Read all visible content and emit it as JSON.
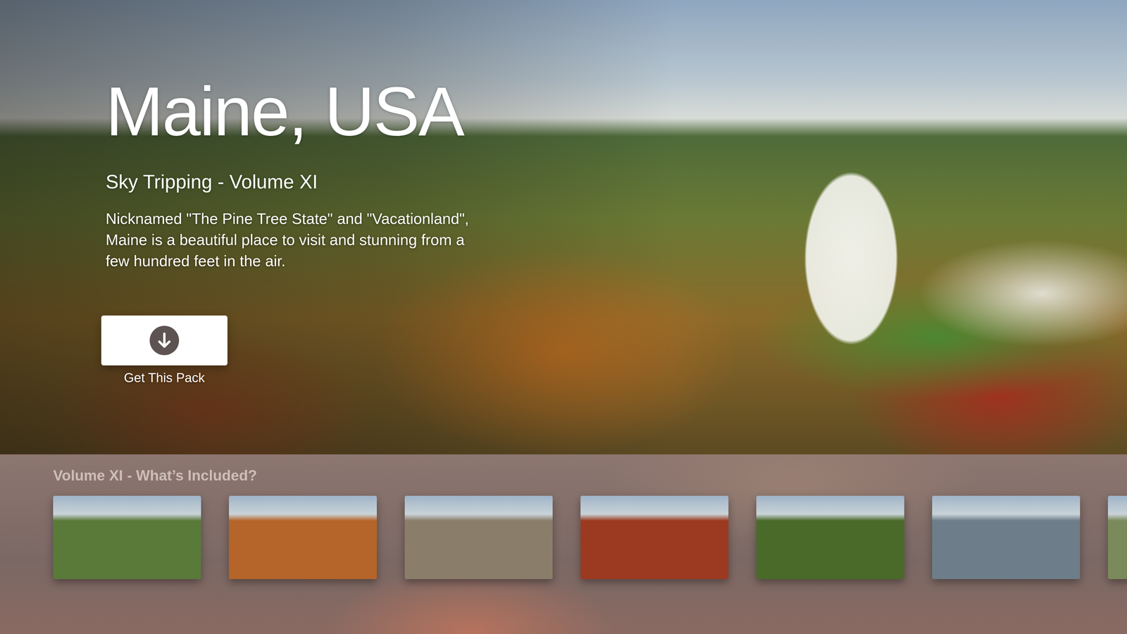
{
  "hero": {
    "title": "Maine, USA",
    "subtitle": "Sky Tripping - Volume XI",
    "description": "Nicknamed \"The Pine Tree State\" and \"Vacationland\", Maine is a beautiful place to visit and stunning from a few hundred feet in the air."
  },
  "action": {
    "label": "Get This Pack"
  },
  "included": {
    "title": "Volume XI - What’s Included?",
    "thumbnails": [
      {
        "color": "#5a7a3a"
      },
      {
        "color": "#b5642a"
      },
      {
        "color": "#8a7d6a"
      },
      {
        "color": "#9b3a20"
      },
      {
        "color": "#4a6a2a"
      },
      {
        "color": "#6d7d8a"
      },
      {
        "color": "#7a8a5a"
      }
    ]
  }
}
